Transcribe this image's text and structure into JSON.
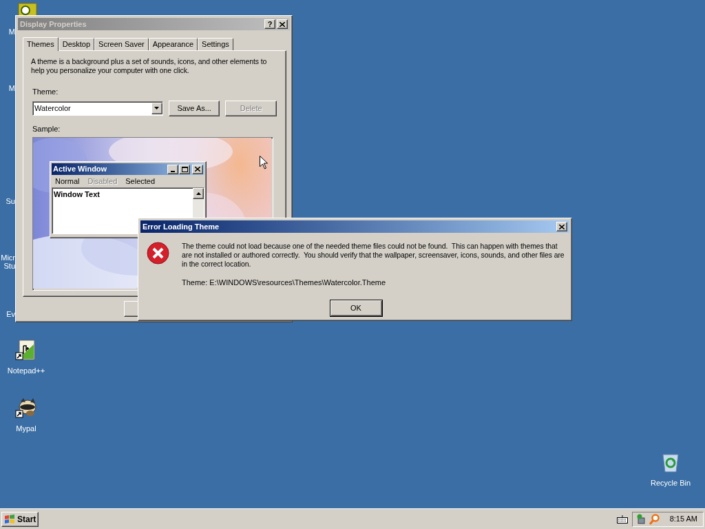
{
  "desktop": {
    "partial_labels": [
      "M",
      "M",
      "Su",
      "Micr",
      "Stu",
      "Ev"
    ],
    "icons": [
      {
        "label": "Notepad++",
        "kind": "notepad"
      },
      {
        "label": "Mypal",
        "kind": "raccoon"
      },
      {
        "label": "Recycle Bin",
        "kind": "recycle"
      }
    ]
  },
  "display_properties": {
    "title": "Display Properties",
    "active": false,
    "help_button": "?",
    "tabs": [
      {
        "label": "Themes",
        "selected": true
      },
      {
        "label": "Desktop",
        "selected": false
      },
      {
        "label": "Screen Saver",
        "selected": false
      },
      {
        "label": "Appearance",
        "selected": false
      },
      {
        "label": "Settings",
        "selected": false
      }
    ],
    "description": "A theme is a background plus a set of sounds, icons, and other elements to help you personalize your computer with one click.",
    "theme_label": "Theme:",
    "theme_value": "Watercolor",
    "buttons": [
      {
        "label": "Save As...",
        "disabled": false
      },
      {
        "label": "Delete",
        "disabled": true
      }
    ],
    "sample_label": "Sample:",
    "preview": {
      "title": "Active Window",
      "menu": [
        {
          "label": "Normal",
          "disabled": false
        },
        {
          "label": "Disabled",
          "disabled": true
        },
        {
          "label": "Selected",
          "disabled": false
        }
      ],
      "text": "Window Text"
    }
  },
  "error_dialog": {
    "title": "Error Loading Theme",
    "active": true,
    "message": "The theme could not load because one of the needed theme files could not be found.  This can happen with themes that are not installed or authored correctly.  You should verify that the wallpaper, screensaver, icons, sounds, and other files are in the correct location.",
    "path": "Theme: E:\\WINDOWS\\resources\\Themes\\Watercolor.Theme",
    "button": "OK"
  },
  "taskbar": {
    "start": "Start",
    "clock": "8:15 AM"
  }
}
